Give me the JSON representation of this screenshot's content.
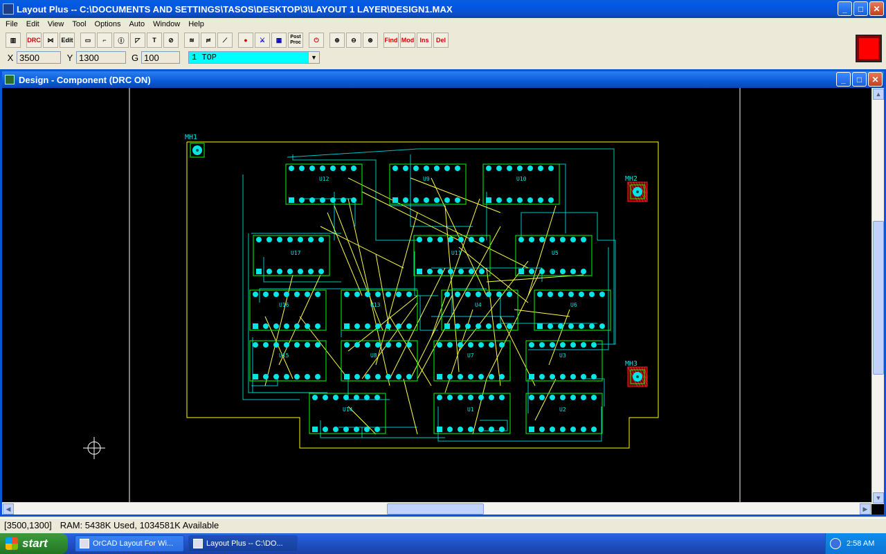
{
  "window": {
    "title": "Layout Plus -- C:\\DOCUMENTS AND SETTINGS\\TASOS\\DESKTOP\\3\\LAYOUT 1 LAYER\\DESIGN1.MAX",
    "min": "_",
    "max": "□",
    "close": "✕"
  },
  "menu": [
    "File",
    "Edit",
    "View",
    "Tool",
    "Options",
    "Auto",
    "Window",
    "Help"
  ],
  "toolbar": {
    "drc": "DRC",
    "edit": "Edit",
    "text": "T",
    "post_proc": "Post Proc",
    "find": "Find",
    "mod": "Mod",
    "ins": "Ins",
    "del": "Del",
    "swatch_color": "#ff0000"
  },
  "coords": {
    "x_label": "X",
    "x_value": "3500",
    "y_label": "Y",
    "y_value": "1300",
    "g_label": "G",
    "g_value": "100",
    "layer": "1  TOP"
  },
  "child_window": {
    "title": "Design - Component (DRC ON)"
  },
  "pcb": {
    "board_color": "#ffff00",
    "trace_color": "#00e6e6",
    "ratsnest_color": "#ffff44",
    "outline_color": "#00ff00",
    "mounting_holes": [
      {
        "label": "MH1"
      },
      {
        "label": "MH2"
      },
      {
        "label": "MH3"
      }
    ],
    "components": [
      {
        "ref": "U12"
      },
      {
        "ref": "U9"
      },
      {
        "ref": "U10"
      },
      {
        "ref": "U17"
      },
      {
        "ref": "U11"
      },
      {
        "ref": "U5"
      },
      {
        "ref": "U16"
      },
      {
        "ref": "U13"
      },
      {
        "ref": "U4"
      },
      {
        "ref": "U6"
      },
      {
        "ref": "U15"
      },
      {
        "ref": "U8"
      },
      {
        "ref": "U7"
      },
      {
        "ref": "U3"
      },
      {
        "ref": "U14"
      },
      {
        "ref": "U1"
      },
      {
        "ref": "U2"
      }
    ]
  },
  "status": {
    "coord": "[3500,1300]",
    "ram": "RAM: 5438K Used, 1034581K Available"
  },
  "taskbar": {
    "start": "start",
    "tasks": [
      {
        "label": "OrCAD Layout For Wi..."
      },
      {
        "label": "Layout Plus -- C:\\DO..."
      }
    ],
    "clock": "2:58 AM"
  }
}
